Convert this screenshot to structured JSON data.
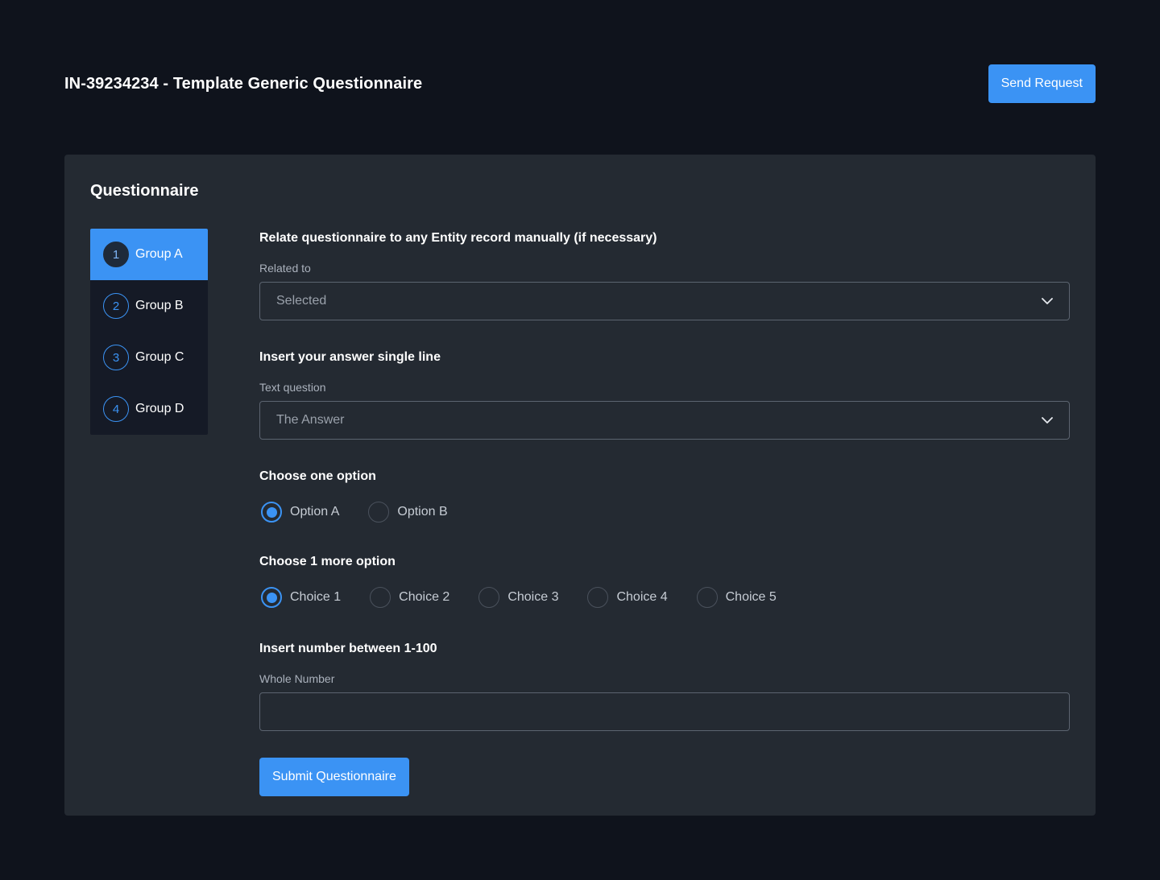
{
  "header": {
    "title": "IN-39234234 - Template Generic Questionnaire",
    "send_label": "Send Request"
  },
  "card": {
    "title": "Questionnaire"
  },
  "steps": [
    {
      "num": "1",
      "label": "Group A",
      "active": true
    },
    {
      "num": "2",
      "label": "Group B",
      "active": false
    },
    {
      "num": "3",
      "label": "Group C",
      "active": false
    },
    {
      "num": "4",
      "label": "Group D",
      "active": false
    }
  ],
  "form": {
    "related": {
      "question": "Relate questionnaire to any Entity record manually (if necessary)",
      "label": "Related to",
      "value": "Selected"
    },
    "text": {
      "question": "Insert your answer single line",
      "label": "Text question",
      "value": "The Answer"
    },
    "one_option": {
      "question": "Choose one option",
      "options": [
        "Option A",
        "Option B"
      ],
      "selected": "Option A"
    },
    "more_option": {
      "question": "Choose 1 more option",
      "options": [
        "Choice 1",
        "Choice 2",
        "Choice 3",
        "Choice 4",
        "Choice 5"
      ],
      "selected": "Choice 1"
    },
    "number": {
      "question": "Insert number between 1-100",
      "label": "Whole Number",
      "value": ""
    },
    "submit_label": "Submit Questionnaire"
  },
  "colors": {
    "accent": "#3b93f4",
    "background": "#0f131c",
    "card": "#242a32",
    "stepper": "#151a26"
  },
  "icons": {
    "dropdown": "chevron-down-icon"
  }
}
